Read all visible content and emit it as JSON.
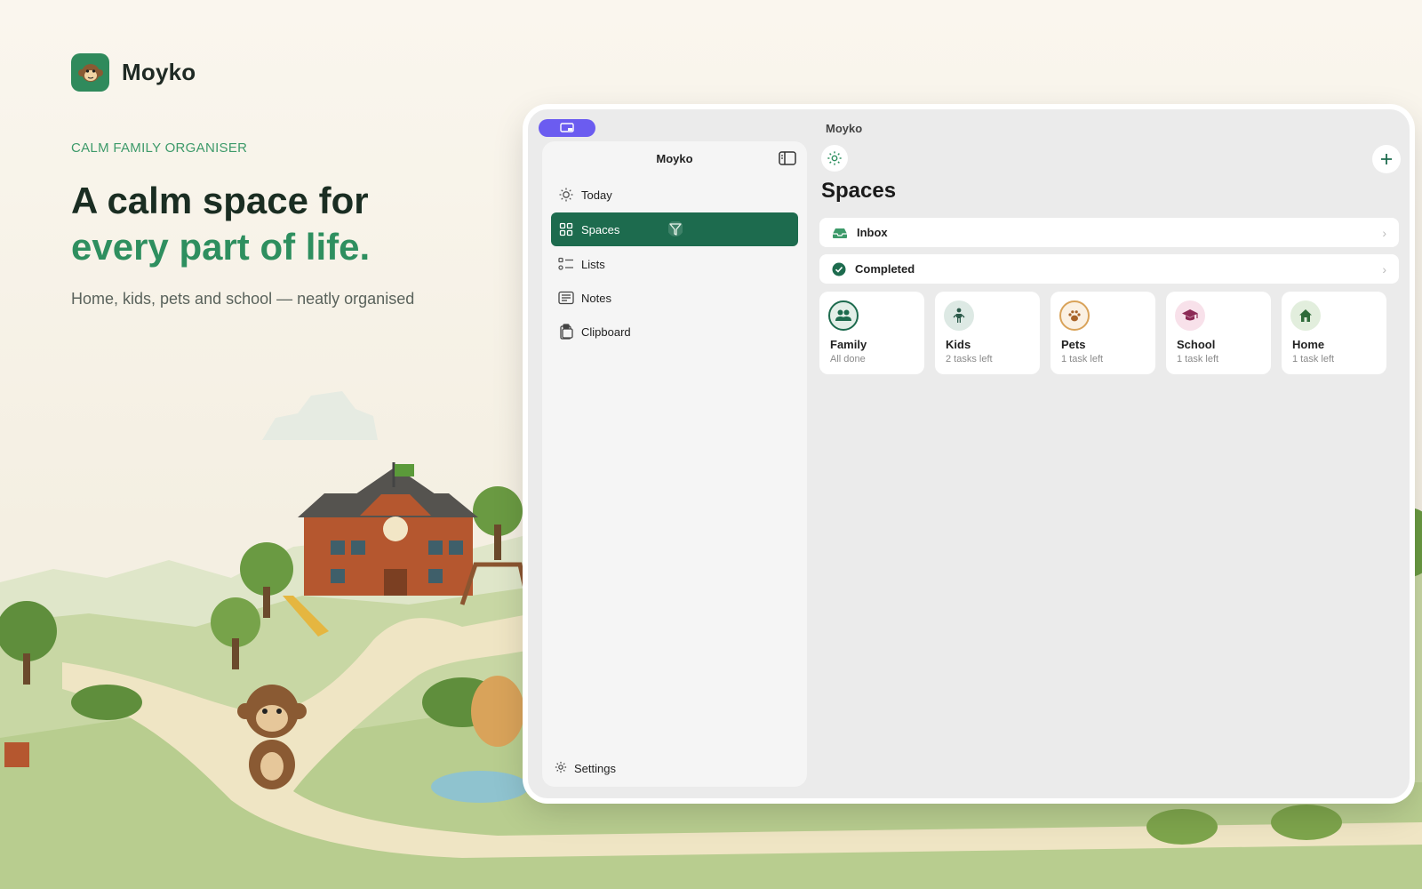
{
  "brand": {
    "name": "Moyko",
    "logo_icon": "monkey-face-icon",
    "color": "#2f8a5c"
  },
  "hero": {
    "eyebrow": "CALM FAMILY ORGANISER",
    "headline_line1": "A calm space for",
    "headline_line2": "every part of life.",
    "subline": "Home, kids, pets and school — neatly organised",
    "accent_color": "#2e8f5f"
  },
  "window": {
    "title": "Moyko",
    "sidebar": {
      "title": "Moyko",
      "items": [
        {
          "label": "Today",
          "icon": "sun-icon",
          "active": false
        },
        {
          "label": "Spaces",
          "icon": "grid-icon",
          "active": true
        },
        {
          "label": "Lists",
          "icon": "checklist-icon",
          "active": false
        },
        {
          "label": "Notes",
          "icon": "notes-icon",
          "active": false
        },
        {
          "label": "Clipboard",
          "icon": "clipboard-icon",
          "active": false
        }
      ],
      "settings_label": "Settings",
      "active_color": "#1d6b4e"
    },
    "main": {
      "title": "Spaces",
      "rows": [
        {
          "label": "Inbox",
          "icon": "inbox-icon"
        },
        {
          "label": "Completed",
          "icon": "check-circle-icon"
        }
      ],
      "spaces": [
        {
          "name": "Family",
          "status": "All done",
          "icon": "family-icon",
          "color": "#1d6b4e"
        },
        {
          "name": "Kids",
          "status": "2 tasks left",
          "icon": "child-icon",
          "color": "#2c5a4a"
        },
        {
          "name": "Pets",
          "status": "1 task left",
          "icon": "paw-icon",
          "color": "#a8642a"
        },
        {
          "name": "School",
          "status": "1 task left",
          "icon": "graduation-cap-icon",
          "color": "#8c2a55"
        },
        {
          "name": "Home",
          "status": "1 task left",
          "icon": "house-icon",
          "color": "#2f6b3a"
        }
      ]
    }
  }
}
